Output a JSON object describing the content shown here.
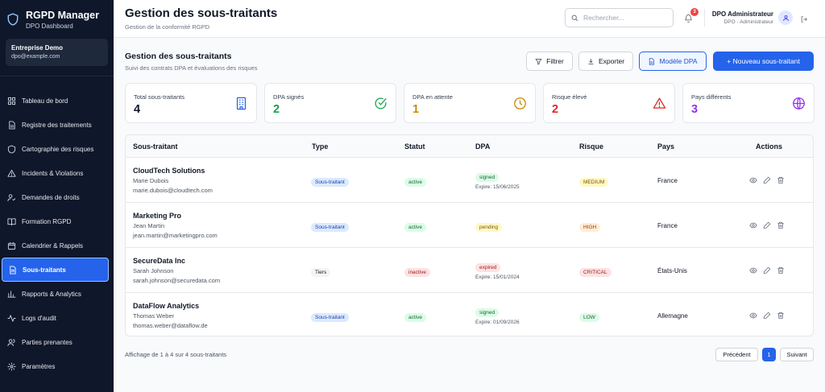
{
  "app": {
    "name": "RGPD Manager",
    "subtitle": "DPO Dashboard"
  },
  "org": {
    "name": "Entreprise Demo",
    "email": "dpo@example.com"
  },
  "sidebar": {
    "items": [
      {
        "label": "Tableau de bord",
        "icon": "dashboard-icon"
      },
      {
        "label": "Registre des traitements",
        "icon": "document-icon"
      },
      {
        "label": "Cartographie des risques",
        "icon": "shield-icon"
      },
      {
        "label": "Incidents & Violations",
        "icon": "warning-icon"
      },
      {
        "label": "Demandes de droits",
        "icon": "user-check-icon"
      },
      {
        "label": "Formation RGPD",
        "icon": "book-icon"
      },
      {
        "label": "Calendrier & Rappels",
        "icon": "calendar-icon"
      },
      {
        "label": "Sous-traitants",
        "icon": "file-icon",
        "active": true
      },
      {
        "label": "Rapports & Analytics",
        "icon": "chart-icon"
      },
      {
        "label": "Logs d'audit",
        "icon": "activity-icon"
      },
      {
        "label": "Parties prenantes",
        "icon": "users-icon"
      },
      {
        "label": "Paramètres",
        "icon": "gear-icon"
      }
    ]
  },
  "header": {
    "title": "Gestion des sous-traitants",
    "subtitle": "Gestion de la conformité RGPD",
    "search_placeholder": "Rechercher...",
    "notifications": "3",
    "user_name": "DPO Administrateur",
    "user_role": "DPO - Administrateur"
  },
  "section": {
    "title": "Gestion des sous-traitants",
    "subtitle": "Suivi des contrats DPA et évaluations des risques",
    "buttons": {
      "filter": "Filtrer",
      "export": "Exporter",
      "template": "Modèle DPA",
      "new": "+ Nouveau sous-traitant"
    }
  },
  "stats": [
    {
      "label": "Total sous-traitants",
      "value": "4",
      "color": "#111827",
      "icon": "building-icon",
      "icon_color": "#2563eb"
    },
    {
      "label": "DPA signés",
      "value": "2",
      "color": "#16a34a",
      "icon": "check-circle-icon",
      "icon_color": "#16a34a"
    },
    {
      "label": "DPA en attente",
      "value": "1",
      "color": "#ca8a04",
      "icon": "clock-icon",
      "icon_color": "#ca8a04"
    },
    {
      "label": "Risque élevé",
      "value": "2",
      "color": "#dc2626",
      "icon": "alert-triangle-icon",
      "icon_color": "#dc2626"
    },
    {
      "label": "Pays différents",
      "value": "3",
      "color": "#9333ea",
      "icon": "globe-icon",
      "icon_color": "#9333ea"
    }
  ],
  "table": {
    "columns": [
      "Sous-traitant",
      "Type",
      "Statut",
      "DPA",
      "Risque",
      "Pays",
      "Actions"
    ],
    "rows": [
      {
        "name": "CloudTech Solutions",
        "contact": "Marie Dubois",
        "email": "marie.dubois@cloudtech.com",
        "type": "Sous-traitant",
        "status": "active",
        "dpa": "signed",
        "expire": "Expire: 15/06/2025",
        "risk": "MEDIUM",
        "country": "France"
      },
      {
        "name": "Marketing Pro",
        "contact": "Jean Martin",
        "email": "jean.martin@marketingpro.com",
        "type": "Sous-traitant",
        "status": "active",
        "dpa": "pending",
        "expire": "",
        "risk": "HIGH",
        "country": "France"
      },
      {
        "name": "SecureData Inc",
        "contact": "Sarah Johnson",
        "email": "sarah.johnson@securedata.com",
        "type": "Tiers",
        "status": "inactive",
        "dpa": "expired",
        "expire": "Expire: 15/01/2024",
        "risk": "CRITICAL",
        "country": "États-Unis"
      },
      {
        "name": "DataFlow Analytics",
        "contact": "Thomas Weber",
        "email": "thomas.weber@dataflow.de",
        "type": "Sous-traitant",
        "status": "active",
        "dpa": "signed",
        "expire": "Expire: 01/09/2026",
        "risk": "LOW",
        "country": "Allemagne"
      }
    ]
  },
  "footer": {
    "summary": "Affichage de 1 à 4 sur 4 sous-traitants",
    "prev": "Précédent",
    "page": "1",
    "next": "Suivant"
  },
  "colors": {
    "accent": "#2563eb",
    "sidebar_bg": "#0f172a"
  }
}
